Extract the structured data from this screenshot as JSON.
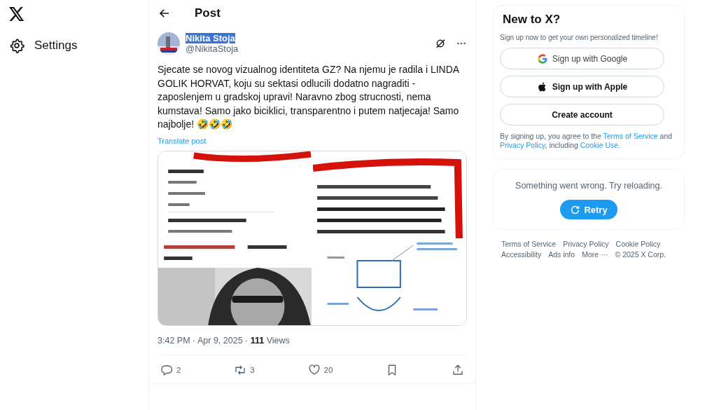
{
  "sidebar": {
    "items": [
      {
        "kind": "settings",
        "label": "Settings"
      }
    ]
  },
  "header": {
    "title": "Post"
  },
  "post": {
    "author": {
      "name": "Nikita Stoja",
      "handle": "@NikitaStoja",
      "highlighted": true
    },
    "text": "Sjecate se novog vizualnog identiteta GZ? Na njemu je radila i LINDA GOLIK HORVAT, koju su sektasi odlucili dodatno nagraditi - zaposlenjem u gradskoj upravi! Naravno zbog strucnosti, nema kumstava! Samo jako biciklici, transparentno i putem natjecaja! Samo najbolje! 🤣🤣🤣",
    "translate": "Translate post",
    "time": "3:42 PM · Apr 9, 2025 · ",
    "views_count": "111",
    "views_label": " Views",
    "actions": [
      {
        "kind": "reply",
        "count": "2"
      },
      {
        "kind": "repost",
        "count": "3"
      },
      {
        "kind": "like",
        "count": "20"
      },
      {
        "kind": "bookmark"
      },
      {
        "kind": "share"
      }
    ]
  },
  "signup": {
    "title": "New to X?",
    "subtitle": "Sign up now to get your own personalized timeline!",
    "buttons": [
      {
        "kind": "google",
        "label": "Sign up with Google"
      },
      {
        "kind": "apple",
        "label": "Sign up with Apple"
      },
      {
        "kind": "plain",
        "label": "Create account"
      }
    ],
    "legal": "By signing up, you agree to the ",
    "links": [
      "Terms of Service",
      "Privacy Policy",
      "Cookie Use."
    ],
    "legal_and": " and ",
    "legal_including": ", including "
  },
  "error": {
    "message": "Something went wrong. Try reloading.",
    "button": "Retry"
  },
  "footer": {
    "links": [
      "Terms of Service",
      "Privacy Policy",
      "Cookie Policy",
      "Accessibility",
      "Ads info",
      "More ···"
    ],
    "copyright": "© 2025 X Corp."
  }
}
